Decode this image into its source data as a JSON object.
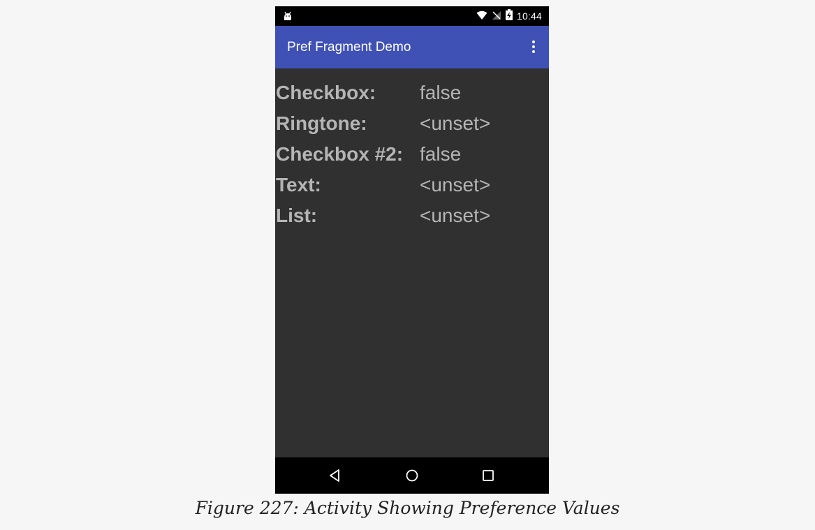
{
  "status_bar": {
    "time": "10:44",
    "left_icon": "android-debug-icon",
    "icons": [
      "wifi-icon",
      "no-signal-icon",
      "battery-charging-icon"
    ]
  },
  "app_bar": {
    "title": "Pref Fragment Demo",
    "overflow_icon": "more-vert-icon",
    "color": "#3f51b5"
  },
  "preferences": [
    {
      "label": "Checkbox:",
      "value": "false"
    },
    {
      "label": "Ringtone:",
      "value": "<unset>"
    },
    {
      "label": "Checkbox #2:",
      "value": "false"
    },
    {
      "label": "Text:",
      "value": "<unset>"
    },
    {
      "label": "List:",
      "value": "<unset>"
    }
  ],
  "nav_bar": {
    "buttons": [
      "back-icon",
      "home-icon",
      "recents-icon"
    ]
  },
  "caption": "Figure 227: Activity Showing Preference Values",
  "colors": {
    "background": "#303030",
    "text": "#b5b5b5",
    "system_bars": "#000000"
  }
}
